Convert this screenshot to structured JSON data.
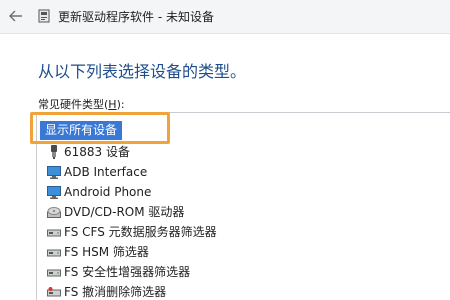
{
  "window": {
    "title": "更新驱动程序软件 - 未知设备",
    "back_icon": "arrow-left-icon",
    "title_icon": "device-manager-icon"
  },
  "main": {
    "heading": "从以下列表选择设备的类型。",
    "list_label_prefix": "常见硬件类型(",
    "list_label_accel": "H",
    "list_label_suffix": "):"
  },
  "list": {
    "selected": "显示所有设备",
    "items": [
      {
        "label": "61883 设备",
        "icon": "device-plug-icon"
      },
      {
        "label": "ADB Interface",
        "icon": "monitor-icon"
      },
      {
        "label": "Android Phone",
        "icon": "monitor-icon"
      },
      {
        "label": "DVD/CD-ROM 驱动器",
        "icon": "optical-drive-icon"
      },
      {
        "label": "FS CFS 元数据服务器筛选器",
        "icon": "drive-icon"
      },
      {
        "label": "FS HSM 筛选器",
        "icon": "drive-icon"
      },
      {
        "label": "FS 安全性增强器筛选器",
        "icon": "drive-icon"
      },
      {
        "label": "FS 撤消删除筛选器",
        "icon": "drive-icon"
      }
    ]
  },
  "colors": {
    "accent": "#1f4e8c",
    "selection": "#3a78d6",
    "annotation": "#f0a23b"
  }
}
